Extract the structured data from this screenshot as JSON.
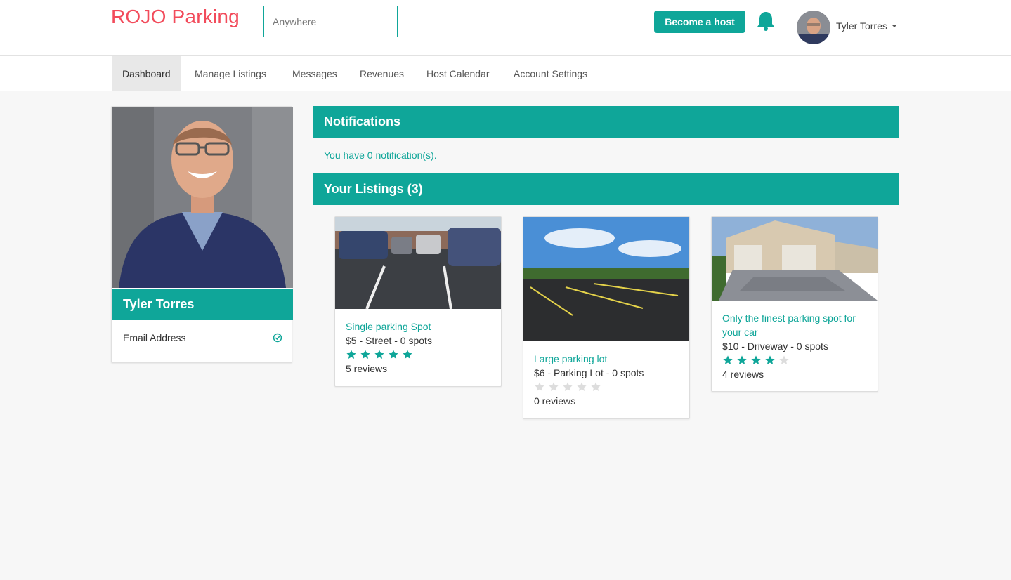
{
  "header": {
    "brand": "ROJO Parking",
    "search_placeholder": "Anywhere",
    "become_host": "Become a host",
    "user_name": "Tyler Torres"
  },
  "nav": {
    "items": [
      {
        "label": "Dashboard",
        "active": true
      },
      {
        "label": "Manage Listings"
      },
      {
        "label": "Messages"
      },
      {
        "label": "Revenues"
      },
      {
        "label": "Host Calendar"
      },
      {
        "label": "Account Settings"
      }
    ]
  },
  "profile": {
    "name": "Tyler Torres",
    "email_label": "Email Address",
    "email_verified": true
  },
  "notifications": {
    "title": "Notifications",
    "text": "You have 0 notification(s)."
  },
  "listings": {
    "title": "Your Listings (3)",
    "items": [
      {
        "title": "Single parking Spot",
        "meta": "$5 - Street - 0 spots",
        "rating": 5,
        "reviews": "5 reviews"
      },
      {
        "title": "Large parking lot",
        "meta": "$6 - Parking Lot - 0 spots",
        "rating": 0,
        "reviews": "0 reviews"
      },
      {
        "title": "Only the finest parking spot for your car",
        "meta": "$10 - Driveway - 0 spots",
        "rating": 4,
        "reviews": "4 reviews"
      }
    ]
  },
  "colors": {
    "brand": "#f24b5b",
    "accent": "#0fa699",
    "star_empty": "#dddddd"
  }
}
